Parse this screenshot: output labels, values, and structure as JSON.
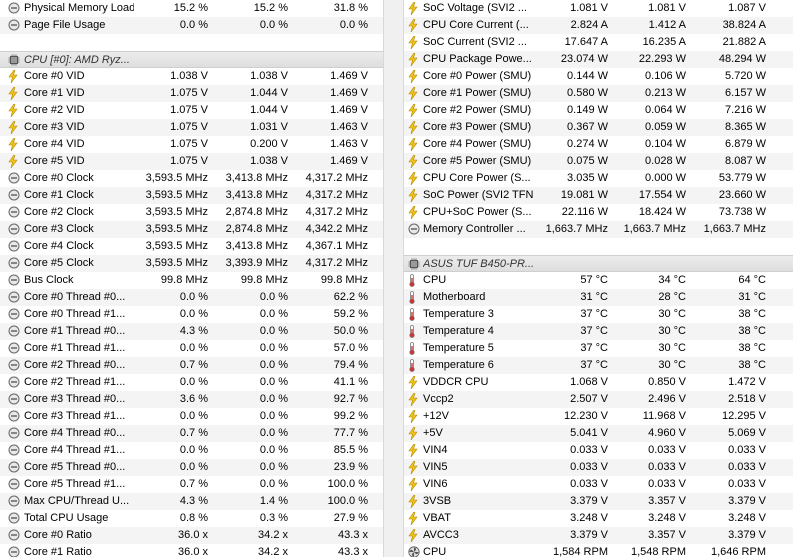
{
  "left": {
    "rows": [
      {
        "icon": "clock",
        "label": "Physical Memory Load",
        "v": [
          "15.2 %",
          "15.2 %",
          "31.8 %"
        ]
      },
      {
        "icon": "clock",
        "label": "Page File Usage",
        "v": [
          "0.0 %",
          "0.0 %",
          "0.0 %"
        ]
      },
      {
        "type": "blank"
      },
      {
        "type": "group",
        "icon": "chip",
        "label": "CPU [#0]: AMD Ryz..."
      },
      {
        "icon": "bolt",
        "label": "Core #0 VID",
        "v": [
          "1.038 V",
          "1.038 V",
          "1.469 V"
        ]
      },
      {
        "icon": "bolt",
        "label": "Core #1 VID",
        "v": [
          "1.075 V",
          "1.044 V",
          "1.469 V"
        ]
      },
      {
        "icon": "bolt",
        "label": "Core #2 VID",
        "v": [
          "1.075 V",
          "1.044 V",
          "1.469 V"
        ]
      },
      {
        "icon": "bolt",
        "label": "Core #3 VID",
        "v": [
          "1.075 V",
          "1.031 V",
          "1.463 V"
        ]
      },
      {
        "icon": "bolt",
        "label": "Core #4 VID",
        "v": [
          "1.075 V",
          "0.200 V",
          "1.463 V"
        ]
      },
      {
        "icon": "bolt",
        "label": "Core #5 VID",
        "v": [
          "1.075 V",
          "1.038 V",
          "1.469 V"
        ]
      },
      {
        "icon": "clock",
        "label": "Core #0 Clock",
        "v": [
          "3,593.5 MHz",
          "3,413.8 MHz",
          "4,317.2 MHz"
        ]
      },
      {
        "icon": "clock",
        "label": "Core #1 Clock",
        "v": [
          "3,593.5 MHz",
          "3,413.8 MHz",
          "4,317.2 MHz"
        ]
      },
      {
        "icon": "clock",
        "label": "Core #2 Clock",
        "v": [
          "3,593.5 MHz",
          "2,874.8 MHz",
          "4,317.2 MHz"
        ]
      },
      {
        "icon": "clock",
        "label": "Core #3 Clock",
        "v": [
          "3,593.5 MHz",
          "2,874.8 MHz",
          "4,342.2 MHz"
        ]
      },
      {
        "icon": "clock",
        "label": "Core #4 Clock",
        "v": [
          "3,593.5 MHz",
          "3,413.8 MHz",
          "4,367.1 MHz"
        ]
      },
      {
        "icon": "clock",
        "label": "Core #5 Clock",
        "v": [
          "3,593.5 MHz",
          "3,393.9 MHz",
          "4,317.2 MHz"
        ]
      },
      {
        "icon": "clock",
        "label": "Bus Clock",
        "v": [
          "99.8 MHz",
          "99.8 MHz",
          "99.8 MHz"
        ]
      },
      {
        "icon": "clock",
        "label": "Core #0 Thread #0...",
        "v": [
          "0.0 %",
          "0.0 %",
          "62.2 %"
        ]
      },
      {
        "icon": "clock",
        "label": "Core #0 Thread #1...",
        "v": [
          "0.0 %",
          "0.0 %",
          "59.2 %"
        ]
      },
      {
        "icon": "clock",
        "label": "Core #1 Thread #0...",
        "v": [
          "4.3 %",
          "0.0 %",
          "50.0 %"
        ]
      },
      {
        "icon": "clock",
        "label": "Core #1 Thread #1...",
        "v": [
          "0.0 %",
          "0.0 %",
          "57.0 %"
        ]
      },
      {
        "icon": "clock",
        "label": "Core #2 Thread #0...",
        "v": [
          "0.7 %",
          "0.0 %",
          "79.4 %"
        ]
      },
      {
        "icon": "clock",
        "label": "Core #2 Thread #1...",
        "v": [
          "0.0 %",
          "0.0 %",
          "41.1 %"
        ]
      },
      {
        "icon": "clock",
        "label": "Core #3 Thread #0...",
        "v": [
          "3.6 %",
          "0.0 %",
          "92.7 %"
        ]
      },
      {
        "icon": "clock",
        "label": "Core #3 Thread #1...",
        "v": [
          "0.0 %",
          "0.0 %",
          "99.2 %"
        ]
      },
      {
        "icon": "clock",
        "label": "Core #4 Thread #0...",
        "v": [
          "0.7 %",
          "0.0 %",
          "77.7 %"
        ]
      },
      {
        "icon": "clock",
        "label": "Core #4 Thread #1...",
        "v": [
          "0.0 %",
          "0.0 %",
          "85.5 %"
        ]
      },
      {
        "icon": "clock",
        "label": "Core #5 Thread #0...",
        "v": [
          "0.0 %",
          "0.0 %",
          "23.9 %"
        ]
      },
      {
        "icon": "clock",
        "label": "Core #5 Thread #1...",
        "v": [
          "0.7 %",
          "0.0 %",
          "100.0 %"
        ]
      },
      {
        "icon": "clock",
        "label": "Max CPU/Thread U...",
        "v": [
          "4.3 %",
          "1.4 %",
          "100.0 %"
        ]
      },
      {
        "icon": "clock",
        "label": "Total CPU Usage",
        "v": [
          "0.8 %",
          "0.3 %",
          "27.9 %"
        ]
      },
      {
        "icon": "clock",
        "label": "Core #0 Ratio",
        "v": [
          "36.0 x",
          "34.2 x",
          "43.3 x"
        ]
      },
      {
        "icon": "clock",
        "label": "Core #1 Ratio",
        "v": [
          "36.0 x",
          "34.2 x",
          "43.3 x"
        ]
      }
    ]
  },
  "right": {
    "rows": [
      {
        "icon": "bolt",
        "label": "SoC Voltage (SVI2 ...",
        "v": [
          "1.081 V",
          "1.081 V",
          "1.087 V"
        ]
      },
      {
        "icon": "bolt",
        "label": "CPU Core Current (...",
        "v": [
          "2.824 A",
          "1.412 A",
          "38.824 A"
        ]
      },
      {
        "icon": "bolt",
        "label": "SoC Current (SVI2 ...",
        "v": [
          "17.647 A",
          "16.235 A",
          "21.882 A"
        ]
      },
      {
        "icon": "bolt",
        "label": "CPU Package Powe...",
        "v": [
          "23.074 W",
          "22.293 W",
          "48.294 W"
        ]
      },
      {
        "icon": "bolt",
        "label": "Core #0 Power (SMU)",
        "v": [
          "0.144 W",
          "0.106 W",
          "5.720 W"
        ]
      },
      {
        "icon": "bolt",
        "label": "Core #1 Power (SMU)",
        "v": [
          "0.580 W",
          "0.213 W",
          "6.157 W"
        ]
      },
      {
        "icon": "bolt",
        "label": "Core #2 Power (SMU)",
        "v": [
          "0.149 W",
          "0.064 W",
          "7.216 W"
        ]
      },
      {
        "icon": "bolt",
        "label": "Core #3 Power (SMU)",
        "v": [
          "0.367 W",
          "0.059 W",
          "8.365 W"
        ]
      },
      {
        "icon": "bolt",
        "label": "Core #4 Power (SMU)",
        "v": [
          "0.274 W",
          "0.104 W",
          "6.879 W"
        ]
      },
      {
        "icon": "bolt",
        "label": "Core #5 Power (SMU)",
        "v": [
          "0.075 W",
          "0.028 W",
          "8.087 W"
        ]
      },
      {
        "icon": "bolt",
        "label": "CPU Core Power (S...",
        "v": [
          "3.035 W",
          "0.000 W",
          "53.779 W"
        ]
      },
      {
        "icon": "bolt",
        "label": "SoC Power (SVI2 TFN)",
        "v": [
          "19.081 W",
          "17.554 W",
          "23.660 W"
        ]
      },
      {
        "icon": "bolt",
        "label": "CPU+SoC Power (S...",
        "v": [
          "22.116 W",
          "18.424 W",
          "73.738 W"
        ]
      },
      {
        "icon": "clock",
        "label": "Memory Controller ...",
        "v": [
          "1,663.7 MHz",
          "1,663.7 MHz",
          "1,663.7 MHz"
        ]
      },
      {
        "type": "blank"
      },
      {
        "type": "group",
        "icon": "chip",
        "label": "ASUS TUF B450-PR..."
      },
      {
        "icon": "therm",
        "label": "CPU",
        "v": [
          "57 °C",
          "34 °C",
          "64 °C"
        ]
      },
      {
        "icon": "therm",
        "label": "Motherboard",
        "v": [
          "31 °C",
          "28 °C",
          "31 °C"
        ]
      },
      {
        "icon": "therm",
        "label": "Temperature 3",
        "v": [
          "37 °C",
          "30 °C",
          "38 °C"
        ]
      },
      {
        "icon": "therm",
        "label": "Temperature 4",
        "v": [
          "37 °C",
          "30 °C",
          "38 °C"
        ]
      },
      {
        "icon": "therm",
        "label": "Temperature 5",
        "v": [
          "37 °C",
          "30 °C",
          "38 °C"
        ]
      },
      {
        "icon": "therm",
        "label": "Temperature 6",
        "v": [
          "37 °C",
          "30 °C",
          "38 °C"
        ]
      },
      {
        "icon": "bolt",
        "label": "VDDCR CPU",
        "v": [
          "1.068 V",
          "0.850 V",
          "1.472 V"
        ]
      },
      {
        "icon": "bolt",
        "label": "Vccp2",
        "v": [
          "2.507 V",
          "2.496 V",
          "2.518 V"
        ]
      },
      {
        "icon": "bolt",
        "label": "+12V",
        "v": [
          "12.230 V",
          "11.968 V",
          "12.295 V"
        ]
      },
      {
        "icon": "bolt",
        "label": "+5V",
        "v": [
          "5.041 V",
          "4.960 V",
          "5.069 V"
        ]
      },
      {
        "icon": "bolt",
        "label": "VIN4",
        "v": [
          "0.033 V",
          "0.033 V",
          "0.033 V"
        ]
      },
      {
        "icon": "bolt",
        "label": "VIN5",
        "v": [
          "0.033 V",
          "0.033 V",
          "0.033 V"
        ]
      },
      {
        "icon": "bolt",
        "label": "VIN6",
        "v": [
          "0.033 V",
          "0.033 V",
          "0.033 V"
        ]
      },
      {
        "icon": "bolt",
        "label": "3VSB",
        "v": [
          "3.379 V",
          "3.357 V",
          "3.379 V"
        ]
      },
      {
        "icon": "bolt",
        "label": "VBAT",
        "v": [
          "3.248 V",
          "3.248 V",
          "3.248 V"
        ]
      },
      {
        "icon": "bolt",
        "label": "AVCC3",
        "v": [
          "3.379 V",
          "3.357 V",
          "3.379 V"
        ]
      },
      {
        "icon": "fan",
        "label": "CPU",
        "v": [
          "1,584 RPM",
          "1,548 RPM",
          "1,646 RPM"
        ]
      }
    ]
  }
}
